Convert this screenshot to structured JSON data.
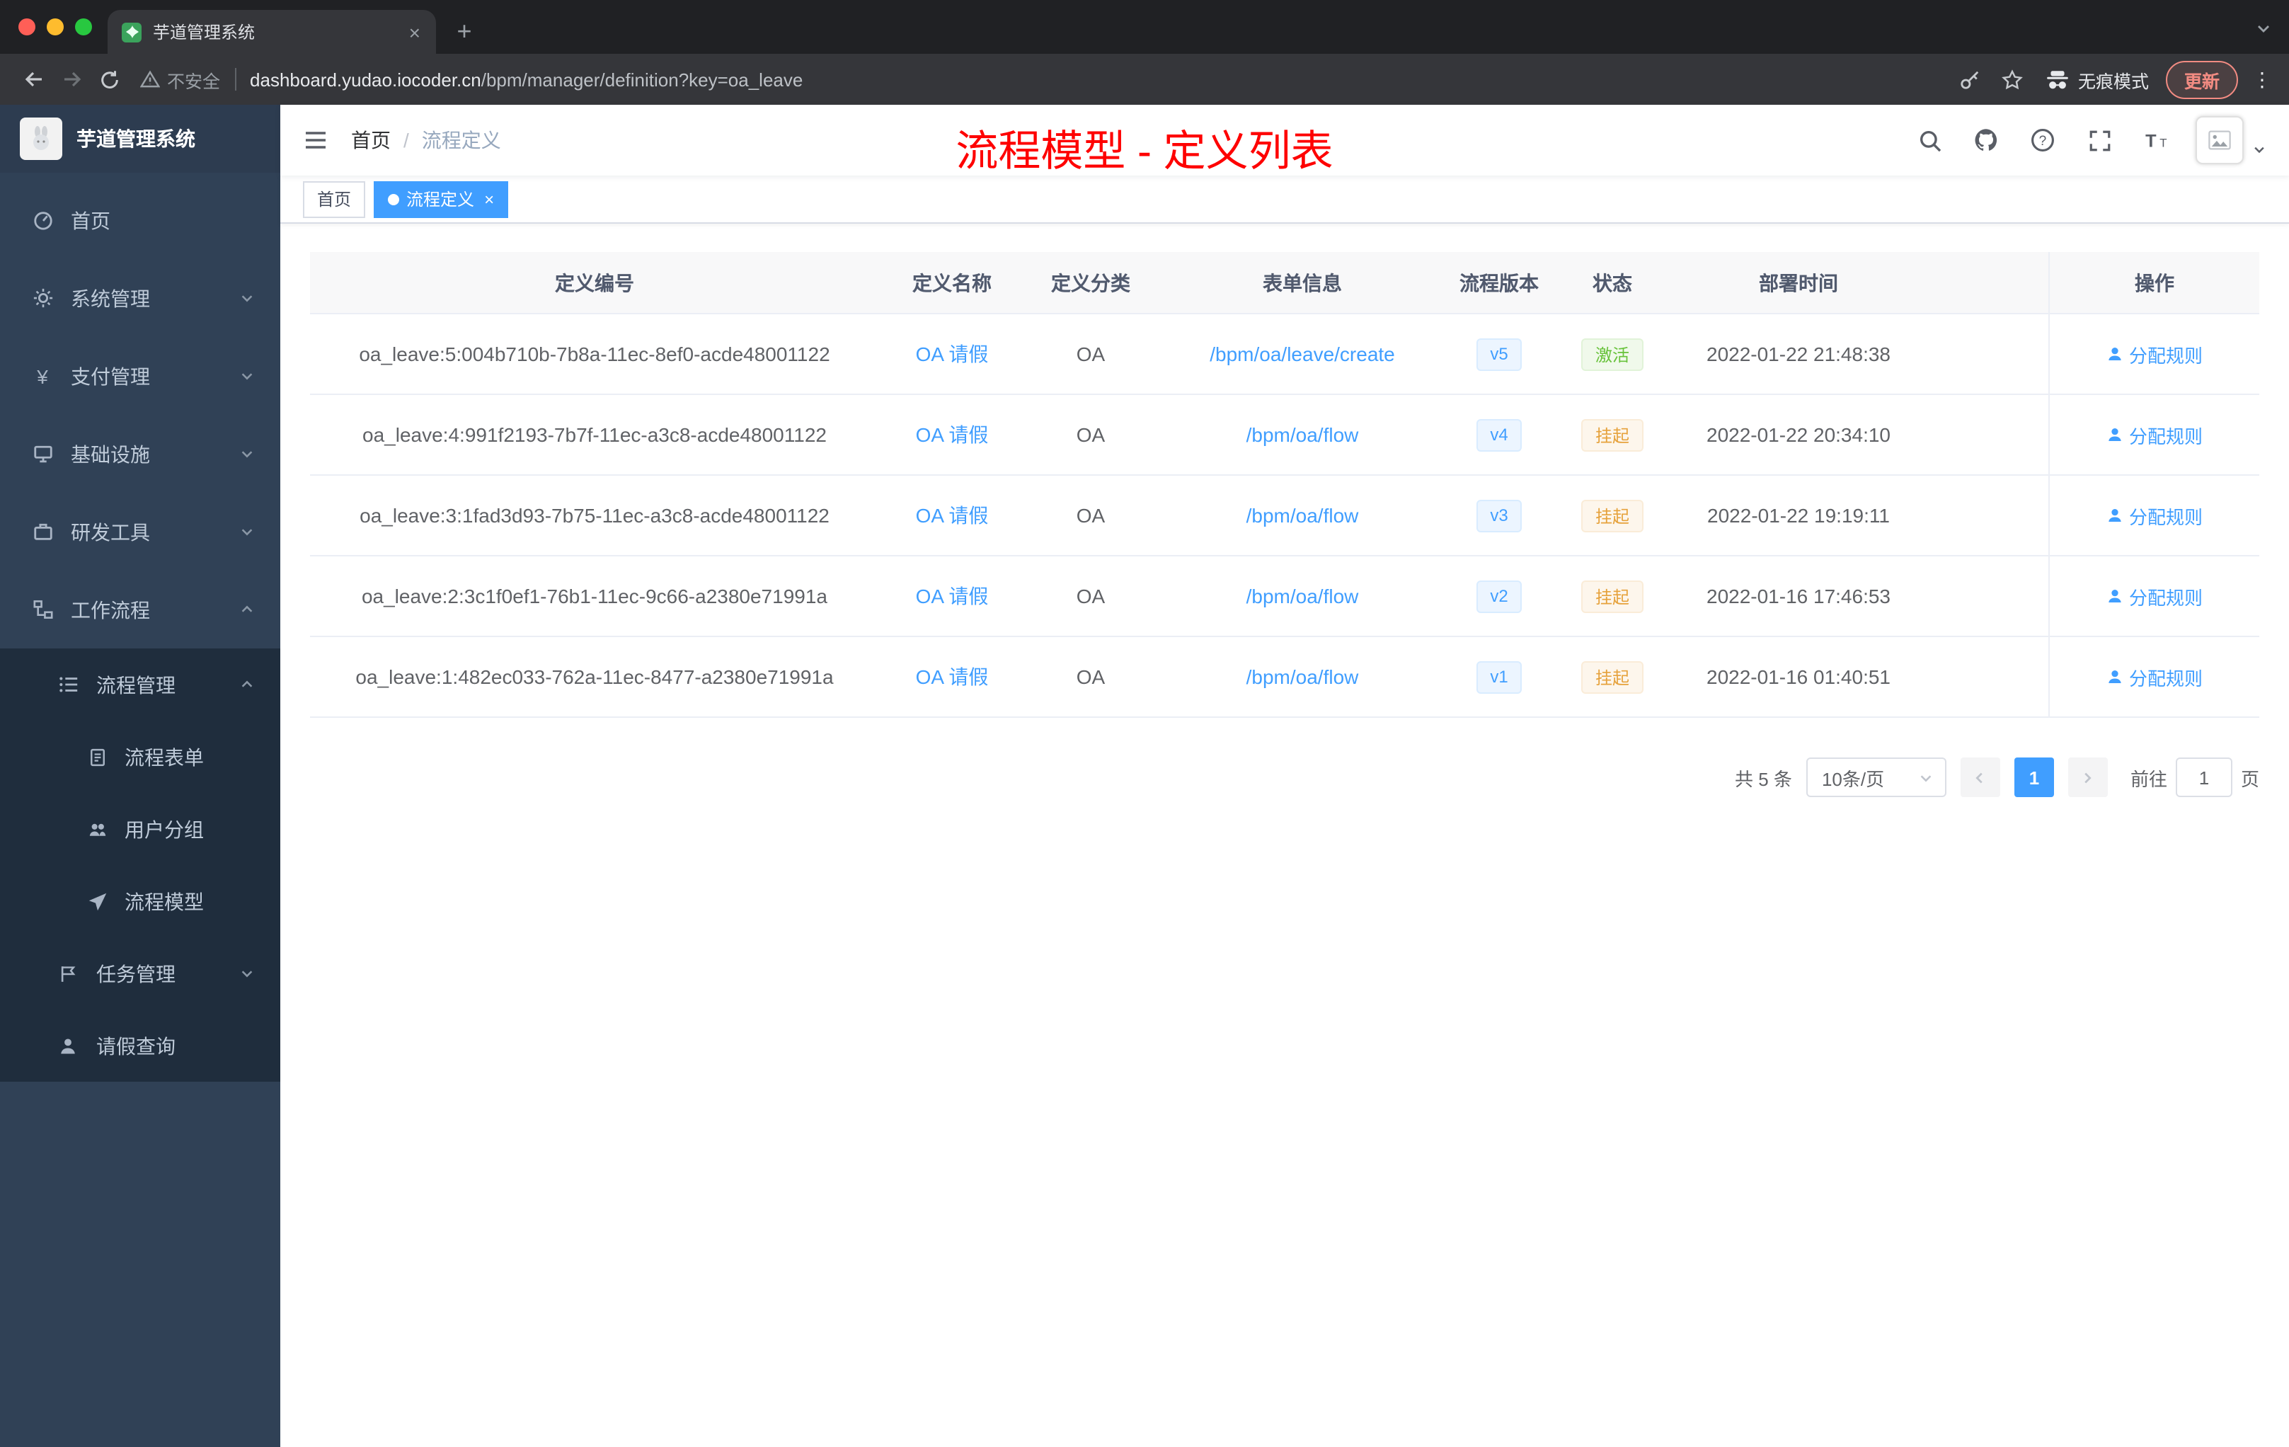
{
  "browser": {
    "tab_title": "芋道管理系统",
    "new_tab_label": "+",
    "security_label": "不安全",
    "url_host": "dashboard.yudao.iocoder.cn",
    "url_path": "/bpm/manager/definition?key=oa_leave",
    "incognito_label": "无痕模式",
    "update_label": "更新",
    "menu_dots": "⋮"
  },
  "sidebar": {
    "logo_title": "芋道管理系统",
    "items": [
      {
        "label": "首页"
      },
      {
        "label": "系统管理"
      },
      {
        "label": "支付管理"
      },
      {
        "label": "基础设施"
      },
      {
        "label": "研发工具"
      },
      {
        "label": "工作流程"
      },
      {
        "label": "流程管理"
      },
      {
        "label": "流程表单"
      },
      {
        "label": "用户分组"
      },
      {
        "label": "流程模型"
      },
      {
        "label": "任务管理"
      },
      {
        "label": "请假查询"
      }
    ]
  },
  "navbar": {
    "breadcrumb_home": "首页",
    "breadcrumb_sep": "/",
    "breadcrumb_current": "流程定义",
    "annotation": "流程模型 - 定义列表"
  },
  "tags": {
    "home": "首页",
    "current": "流程定义",
    "close": "×"
  },
  "table": {
    "columns": [
      "定义编号",
      "定义名称",
      "定义分类",
      "表单信息",
      "流程版本",
      "状态",
      "部署时间",
      "操作"
    ],
    "rows": [
      {
        "id": "oa_leave:5:004b710b-7b8a-11ec-8ef0-acde48001122",
        "name": "OA 请假",
        "category": "OA",
        "form": "/bpm/oa/leave/create",
        "version": "v5",
        "status": "激活",
        "status_type": "success",
        "deploy_time": "2022-01-22 21:48:38",
        "action": "分配规则"
      },
      {
        "id": "oa_leave:4:991f2193-7b7f-11ec-a3c8-acde48001122",
        "name": "OA 请假",
        "category": "OA",
        "form": "/bpm/oa/flow",
        "version": "v4",
        "status": "挂起",
        "status_type": "warning",
        "deploy_time": "2022-01-22 20:34:10",
        "action": "分配规则"
      },
      {
        "id": "oa_leave:3:1fad3d93-7b75-11ec-a3c8-acde48001122",
        "name": "OA 请假",
        "category": "OA",
        "form": "/bpm/oa/flow",
        "version": "v3",
        "status": "挂起",
        "status_type": "warning",
        "deploy_time": "2022-01-22 19:19:11",
        "action": "分配规则"
      },
      {
        "id": "oa_leave:2:3c1f0ef1-76b1-11ec-9c66-a2380e71991a",
        "name": "OA 请假",
        "category": "OA",
        "form": "/bpm/oa/flow",
        "version": "v2",
        "status": "挂起",
        "status_type": "warning",
        "deploy_time": "2022-01-16 17:46:53",
        "action": "分配规则"
      },
      {
        "id": "oa_leave:1:482ec033-762a-11ec-8477-a2380e71991a",
        "name": "OA 请假",
        "category": "OA",
        "form": "/bpm/oa/flow",
        "version": "v1",
        "status": "挂起",
        "status_type": "warning",
        "deploy_time": "2022-01-16 01:40:51",
        "action": "分配规则"
      }
    ]
  },
  "pagination": {
    "total": "共 5 条",
    "page_size": "10条/页",
    "current_page": "1",
    "goto_label": "前往",
    "goto_value": "1",
    "goto_unit": "页"
  },
  "colors": {
    "accent": "#409eff",
    "success": "#67c23a",
    "warning": "#e6a23c",
    "annotation_red": "#fe0000",
    "sidebar_bg": "#304156",
    "submenu_bg": "#1f2d3d"
  }
}
